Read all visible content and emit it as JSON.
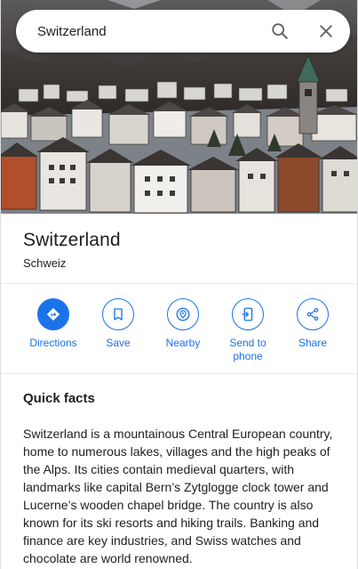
{
  "search": {
    "value": "Switzerland",
    "search_icon": "search-icon",
    "close_icon": "close-icon"
  },
  "hero": {
    "image": "photo of Swiss alpine village with chalets and church tower"
  },
  "place": {
    "title": "Switzerland",
    "subtitle": "Schweiz"
  },
  "actions": [
    {
      "label": "Directions",
      "icon": "directions-icon",
      "primary": true
    },
    {
      "label": "Save",
      "icon": "bookmark-icon",
      "primary": false
    },
    {
      "label": "Nearby",
      "icon": "nearby-icon",
      "primary": false
    },
    {
      "label": "Send to phone",
      "icon": "send-to-phone-icon",
      "primary": false
    },
    {
      "label": "Share",
      "icon": "share-icon",
      "primary": false
    }
  ],
  "quick_facts": {
    "heading": "Quick facts",
    "body": "Switzerland is a mountainous Central European country, home to numerous lakes, villages and the high peaks of the Alps. Its cities contain medieval quarters, with landmarks like capital Bern’s Zytglogge clock tower and Lucerne’s wooden chapel bridge. The country is also known for its ski resorts and hiking trails. Banking and finance are key industries, and Swiss watches and chocolate are world renowned."
  },
  "colors": {
    "accent": "#1a73e8",
    "text": "#202124",
    "divider": "#e8eaed"
  }
}
